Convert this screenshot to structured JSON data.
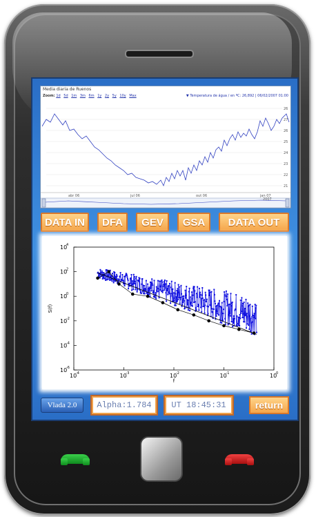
{
  "web_chart": {
    "title": "Media diaria de Ruenos",
    "zoom_label": "Zoom:",
    "zoom_options": [
      "1d",
      "5d",
      "1m",
      "3m",
      "6m",
      "1y",
      "2y",
      "5y",
      "10y",
      "Max"
    ],
    "legend": "▼ Temperatura de água / en ºC: 26,892 | 06/02/2007 01:00",
    "y_ticks": [
      "26",
      "27",
      "26",
      "25",
      "24",
      "23",
      "22",
      "21"
    ],
    "x_ticks": [
      "abr 06",
      "jul 06",
      "out 06",
      "jan 07"
    ],
    "navigator_label": "2007"
  },
  "toolbar": {
    "data_in": "DATA IN",
    "dfa": "DFA",
    "gev": "GEV",
    "gsa": "GSA",
    "data_out": "DATA OUT"
  },
  "chart_data": {
    "type": "scatter",
    "xlabel": "f",
    "ylabel": "S(f)",
    "x_scale": "log",
    "y_scale": "log",
    "xlim": [
      0.0001,
      1
    ],
    "ylim": [
      1e-06,
      10000
    ],
    "x_ticks": [
      "10",
      "10",
      "10",
      "10",
      "10"
    ],
    "x_tick_exponents": [
      "-4",
      "-3",
      "-2",
      "-1",
      "0"
    ],
    "y_ticks": [
      "10",
      "10",
      "10",
      "10",
      "10",
      "10"
    ],
    "y_tick_exponents": [
      "4",
      "2",
      "0",
      "-2",
      "-4",
      "-6"
    ],
    "series_color": "#1010e0",
    "binned_points": [
      {
        "x": 0.0003,
        "y": 30
      },
      {
        "x": 0.0005,
        "y": 100
      },
      {
        "x": 0.0008,
        "y": 10
      },
      {
        "x": 0.0015,
        "y": 1.5
      },
      {
        "x": 0.003,
        "y": 1
      },
      {
        "x": 0.006,
        "y": 0.3
      },
      {
        "x": 0.012,
        "y": 0.08
      },
      {
        "x": 0.025,
        "y": 0.03
      },
      {
        "x": 0.05,
        "y": 0.01
      },
      {
        "x": 0.1,
        "y": 0.004
      },
      {
        "x": 0.2,
        "y": 0.002
      },
      {
        "x": 0.4,
        "y": 0.001
      }
    ],
    "fit_line": {
      "x": [
        0.0003,
        0.45
      ],
      "y": [
        80,
        0.0008
      ]
    }
  },
  "footer": {
    "app_label": "Vlada 2.0",
    "alpha": "Alpha:1.784",
    "time": "UT 18:45:31",
    "return_label": "return"
  },
  "colors": {
    "screen_blue": "#3f8fe0",
    "button_orange": "#f5a64a",
    "call_green": "#1fb02e",
    "end_red": "#d02020"
  }
}
